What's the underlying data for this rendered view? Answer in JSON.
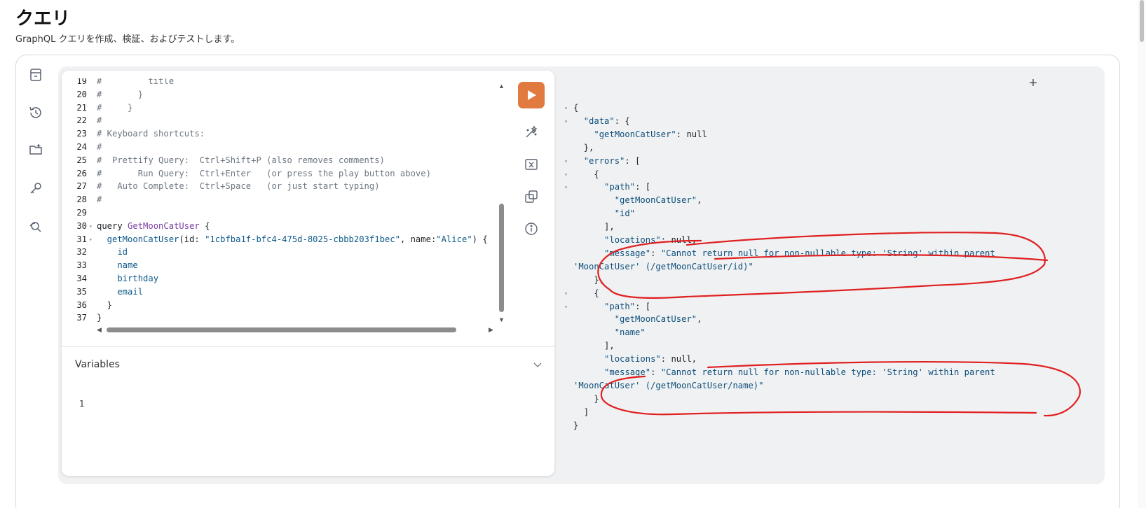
{
  "header": {
    "title": "クエリ",
    "subtitle": "GraphQL クエリを作成、検証、およびテストします。"
  },
  "sidebar": {
    "icons": [
      "docs-icon",
      "history-icon",
      "folder-add-icon",
      "key-icon",
      "explorer-icon"
    ]
  },
  "editor": {
    "lines": [
      {
        "n": "19",
        "text": "#         title"
      },
      {
        "n": "20",
        "text": "#       }"
      },
      {
        "n": "21",
        "text": "#     }"
      },
      {
        "n": "22",
        "text": "#"
      },
      {
        "n": "23",
        "text": "# Keyboard shortcuts:"
      },
      {
        "n": "24",
        "text": "#"
      },
      {
        "n": "25",
        "text": "#  Prettify Query:  Ctrl+Shift+P (also removes comments)"
      },
      {
        "n": "26",
        "text": "#       Run Query:  Ctrl+Enter   (or press the play button above)"
      },
      {
        "n": "27",
        "text": "#   Auto Complete:  Ctrl+Space   (or just start typing)"
      },
      {
        "n": "28",
        "text": "#"
      },
      {
        "n": "29",
        "text": ""
      },
      {
        "n": "30",
        "kw": "query",
        "def": "GetMoonCatUser",
        "rest": " {"
      },
      {
        "n": "31",
        "field": "  getMoonCatUser",
        "args": "(id: ",
        "str1": "\"1cbfba1f-bfc4-475d-8025-cbbb203f1bec\"",
        "mid": ", name:",
        "str2": "\"Alice\"",
        "end": ") {"
      },
      {
        "n": "32",
        "field": "    id"
      },
      {
        "n": "33",
        "field": "    name"
      },
      {
        "n": "34",
        "field": "    birthday"
      },
      {
        "n": "35",
        "field": "    email"
      },
      {
        "n": "36",
        "text": "  }"
      },
      {
        "n": "37",
        "text": "}"
      }
    ]
  },
  "toolbar": {
    "run": "run-query",
    "prettify": "prettify",
    "merge": "merge-fragments",
    "copy": "copy-query",
    "info": "info"
  },
  "variables": {
    "label": "Variables",
    "line": "1"
  },
  "result": {
    "lines": [
      {
        "fold": true,
        "indent": 0,
        "parts": [
          [
            "p",
            "{"
          ]
        ]
      },
      {
        "fold": true,
        "indent": 1,
        "parts": [
          [
            "k",
            "\"data\""
          ],
          [
            "p",
            ": {"
          ]
        ]
      },
      {
        "fold": false,
        "indent": 2,
        "parts": [
          [
            "k",
            "\"getMoonCatUser\""
          ],
          [
            "p",
            ": "
          ],
          [
            "n",
            "null"
          ]
        ]
      },
      {
        "fold": false,
        "indent": 1,
        "parts": [
          [
            "p",
            "},"
          ]
        ]
      },
      {
        "fold": true,
        "indent": 1,
        "parts": [
          [
            "k",
            "\"errors\""
          ],
          [
            "p",
            ": ["
          ]
        ]
      },
      {
        "fold": true,
        "indent": 2,
        "parts": [
          [
            "p",
            "{"
          ]
        ]
      },
      {
        "fold": true,
        "indent": 3,
        "parts": [
          [
            "k",
            "\"path\""
          ],
          [
            "p",
            ": ["
          ]
        ]
      },
      {
        "fold": false,
        "indent": 4,
        "parts": [
          [
            "s",
            "\"getMoonCatUser\""
          ],
          [
            "p",
            ","
          ]
        ]
      },
      {
        "fold": false,
        "indent": 4,
        "parts": [
          [
            "s",
            "\"id\""
          ]
        ]
      },
      {
        "fold": false,
        "indent": 3,
        "parts": [
          [
            "p",
            "],"
          ]
        ]
      },
      {
        "fold": false,
        "indent": 3,
        "parts": [
          [
            "k",
            "\"locations\""
          ],
          [
            "p",
            ": "
          ],
          [
            "n",
            "null"
          ],
          [
            "p",
            ","
          ]
        ]
      },
      {
        "fold": false,
        "indent": 3,
        "parts": [
          [
            "k",
            "\"message\""
          ],
          [
            "p",
            ": "
          ],
          [
            "s",
            "\"Cannot return null for non-nullable type: 'String' within parent"
          ]
        ]
      },
      {
        "fold": false,
        "indent": 0,
        "parts": [
          [
            "s",
            "'MoonCatUser' (/getMoonCatUser/id)\""
          ]
        ]
      },
      {
        "fold": false,
        "indent": 2,
        "parts": [
          [
            "p",
            "},"
          ]
        ]
      },
      {
        "fold": true,
        "indent": 2,
        "parts": [
          [
            "p",
            "{"
          ]
        ]
      },
      {
        "fold": true,
        "indent": 3,
        "parts": [
          [
            "k",
            "\"path\""
          ],
          [
            "p",
            ": ["
          ]
        ]
      },
      {
        "fold": false,
        "indent": 4,
        "parts": [
          [
            "s",
            "\"getMoonCatUser\""
          ],
          [
            "p",
            ","
          ]
        ]
      },
      {
        "fold": false,
        "indent": 4,
        "parts": [
          [
            "s",
            "\"name\""
          ]
        ]
      },
      {
        "fold": false,
        "indent": 3,
        "parts": [
          [
            "p",
            "],"
          ]
        ]
      },
      {
        "fold": false,
        "indent": 3,
        "parts": [
          [
            "k",
            "\"locations\""
          ],
          [
            "p",
            ": "
          ],
          [
            "n",
            "null"
          ],
          [
            "p",
            ","
          ]
        ]
      },
      {
        "fold": false,
        "indent": 3,
        "parts": [
          [
            "k",
            "\"message\""
          ],
          [
            "p",
            ": "
          ],
          [
            "s",
            "\"Cannot return null for non-nullable type: 'String' within parent"
          ]
        ]
      },
      {
        "fold": false,
        "indent": 0,
        "parts": [
          [
            "s",
            "'MoonCatUser' (/getMoonCatUser/name)\""
          ]
        ]
      },
      {
        "fold": false,
        "indent": 2,
        "parts": [
          [
            "p",
            "}"
          ]
        ]
      },
      {
        "fold": false,
        "indent": 1,
        "parts": [
          [
            "p",
            "]"
          ]
        ]
      },
      {
        "fold": false,
        "indent": 0,
        "parts": [
          [
            "p",
            "}"
          ]
        ]
      }
    ]
  },
  "colors": {
    "run_button": "#e07a3f",
    "annotation": "#e02020"
  }
}
